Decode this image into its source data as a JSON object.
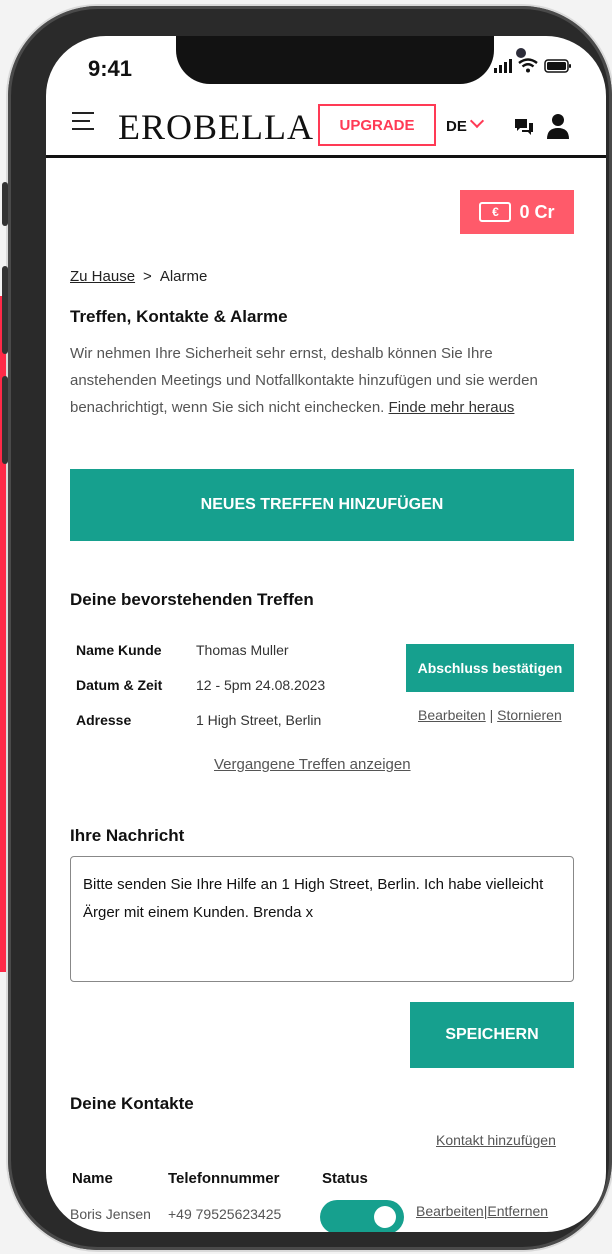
{
  "status_bar": {
    "time": "9:41"
  },
  "header": {
    "logo": "EROBELLA",
    "upgrade_label": "UPGRADE",
    "language": "DE"
  },
  "credits": {
    "label": "0 Cr",
    "icon_text": "€"
  },
  "breadcrumb": {
    "home": "Zu Hause",
    "separator": ">",
    "current": "Alarme"
  },
  "page": {
    "title": "Treffen, Kontakte & Alarme",
    "intro": "Wir nehmen Ihre Sicherheit sehr ernst, deshalb können Sie Ihre anstehenden Meetings und Notfallkontakte hinzufügen und sie werden benachrichtigt, wenn Sie sich nicht einchecken.",
    "intro_link": "Finde mehr heraus",
    "new_meeting_button": "NEUES TREFFEN HINZUFÜGEN"
  },
  "meetings": {
    "title": "Deine bevorstehenden Treffen",
    "rows": [
      {
        "key": "Name Kunde",
        "value": "Thomas Muller"
      },
      {
        "key": "Datum & Zeit",
        "value": "12 - 5pm 24.08.2023"
      },
      {
        "key": "Adresse",
        "value": "1 High Street, Berlin"
      }
    ],
    "confirm_button": "Abschluss bestätigen",
    "edit_link": "Bearbeiten",
    "link_separator": "|",
    "cancel_link": "Stornieren",
    "past_link": "Vergangene Treffen anzeigen"
  },
  "message": {
    "title": "Ihre Nachricht",
    "text": "Bitte senden Sie Ihre Hilfe an 1 High Street, Berlin. Ich habe vielleicht Ärger mit einem Kunden. Brenda x",
    "save_button": "SPEICHERN"
  },
  "contacts": {
    "title": "Deine Kontakte",
    "add_link": "Kontakt hinzufügen",
    "columns": [
      "Name",
      "Telefonnummer",
      "Status"
    ],
    "rows": [
      {
        "name": "Boris Jensen",
        "phone": "+49 79525623425",
        "status_on": true
      }
    ],
    "edit_link": "Bearbeiten",
    "link_separator": "|",
    "remove_link": "Entfernen"
  },
  "colors": {
    "accent_teal": "#16a08e",
    "accent_red": "#ff3a55",
    "side_band": "#ff2a48"
  }
}
